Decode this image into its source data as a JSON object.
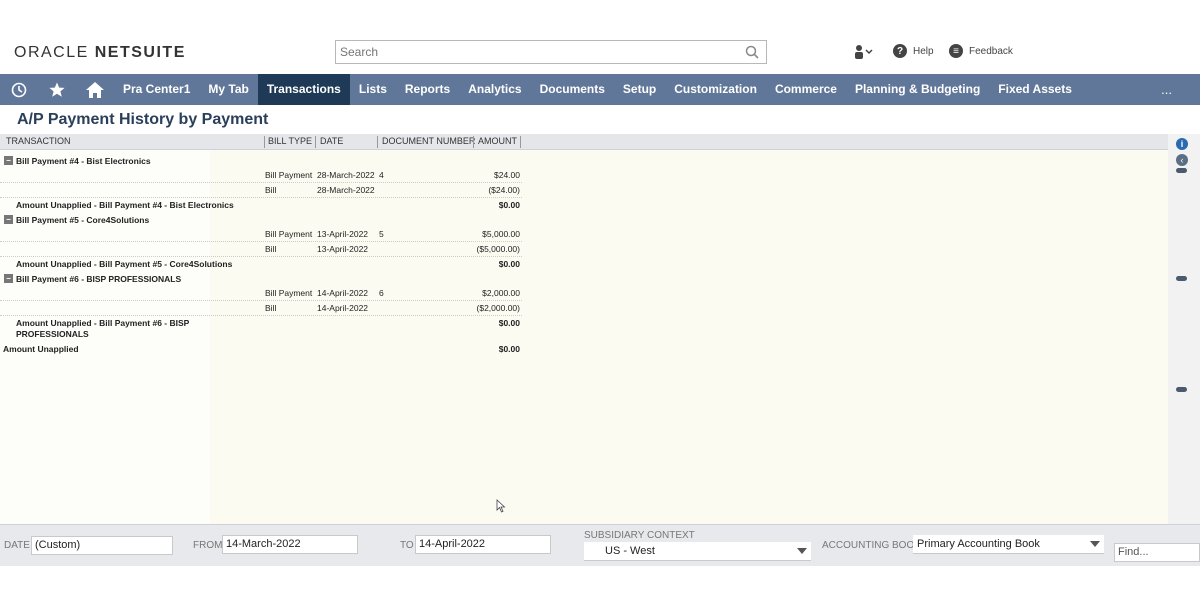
{
  "header": {
    "logo_left": "ORACLE",
    "logo_right": "NETSUITE",
    "search_placeholder": "Search",
    "help_label": "Help",
    "feedback_label": "Feedback"
  },
  "nav": {
    "items": [
      "Pra Center1",
      "My Tab",
      "Transactions",
      "Lists",
      "Reports",
      "Analytics",
      "Documents",
      "Setup",
      "Customization",
      "Commerce",
      "Planning & Budgeting",
      "Fixed Assets"
    ],
    "active": "Transactions",
    "more": "..."
  },
  "page": {
    "title": "A/P Payment History by Payment"
  },
  "report": {
    "columns": [
      "TRANSACTION",
      "BILL TYPE",
      "DATE",
      "DOCUMENT NUMBER",
      "AMOUNT"
    ],
    "groups": [
      {
        "name": "Bill Payment #4 - Bist Electronics",
        "lines": [
          {
            "type": "Bill Payment",
            "date": "28-March-2022",
            "doc": "4",
            "amount": "$24.00"
          },
          {
            "type": "Bill",
            "date": "28-March-2022",
            "doc": "",
            "amount": "($24.00)"
          }
        ],
        "subtotal_label": "Amount Unapplied - Bill Payment #4 - Bist Electronics",
        "subtotal_amount": "$0.00"
      },
      {
        "name": "Bill Payment #5 - Core4Solutions",
        "lines": [
          {
            "type": "Bill Payment",
            "date": "13-April-2022",
            "doc": "5",
            "amount": "$5,000.00"
          },
          {
            "type": "Bill",
            "date": "13-April-2022",
            "doc": "",
            "amount": "($5,000.00)"
          }
        ],
        "subtotal_label": "Amount Unapplied - Bill Payment #5 - Core4Solutions",
        "subtotal_amount": "$0.00"
      },
      {
        "name": "Bill Payment #6 - BISP PROFESSIONALS",
        "lines": [
          {
            "type": "Bill Payment",
            "date": "14-April-2022",
            "doc": "6",
            "amount": "$2,000.00"
          },
          {
            "type": "Bill",
            "date": "14-April-2022",
            "doc": "",
            "amount": "($2,000.00)"
          }
        ],
        "subtotal_label_1": "Amount Unapplied - Bill Payment #6 - BISP",
        "subtotal_label_2": "PROFESSIONALS",
        "subtotal_amount": "$0.00"
      }
    ],
    "total_label": "Amount Unapplied",
    "total_amount": "$0.00",
    "expander_symbol": "−"
  },
  "filters": {
    "date_label": "DATE",
    "date_value": "(Custom)",
    "from_label": "FROM",
    "from_value": "14-March-2022",
    "to_label": "TO",
    "to_value": "14-April-2022",
    "subsidiary_label": "SUBSIDIARY CONTEXT",
    "subsidiary_value": "US - West",
    "book_label": "ACCOUNTING BOOK",
    "book_value": "Primary Accounting Book",
    "find_placeholder": "Find..."
  },
  "colors": {
    "nav_bg": "#607799",
    "nav_active": "#1e3a57",
    "title": "#2a3f5a"
  }
}
